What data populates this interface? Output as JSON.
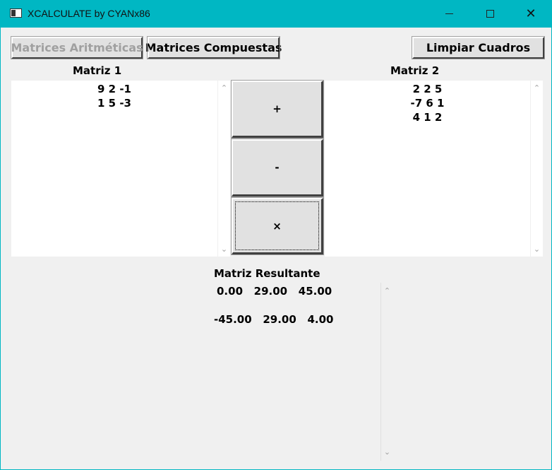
{
  "window": {
    "title": "XCALCULATE by CYANx86",
    "minimize_glyph": "—",
    "close_glyph": "✕"
  },
  "toolbar": {
    "arith_label": "Matrices Aritméticas",
    "compound_label": "Matrices Compuestas",
    "clear_label": "Limpiar Cuadros"
  },
  "matrix1": {
    "label": "Matriz 1",
    "rows": [
      "9 2 -1",
      "1 5 -3"
    ]
  },
  "matrix2": {
    "label": "Matriz 2",
    "rows": [
      "2 2 5",
      "-7 6 1",
      "4 1 2"
    ]
  },
  "operations": {
    "add": "+",
    "subtract": "-",
    "multiply": "×"
  },
  "result": {
    "label": "Matriz Resultante",
    "rows": [
      "0.00   29.00   45.00",
      "-45.00   29.00   4.00"
    ]
  },
  "icons": {
    "scroll_up": "⌃",
    "scroll_down": "⌄"
  },
  "colors": {
    "titlebar": "#00b7c3",
    "window_bg": "#f0f0f0",
    "button_face": "#e1e1e1",
    "disabled_text": "#a0a0a0"
  }
}
